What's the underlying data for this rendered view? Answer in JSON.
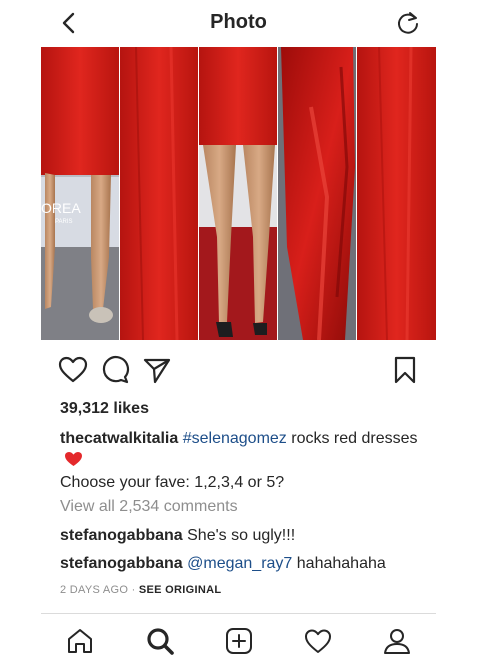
{
  "header": {
    "title": "Photo",
    "back_icon": "chevron-left-icon",
    "refresh_icon": "refresh-icon"
  },
  "photo": {
    "panels": 5,
    "watermark_text": "OREA",
    "watermark_sub": "PARIS",
    "dress_color": "#d9221c"
  },
  "actions": {
    "icons": [
      "heart-icon",
      "comment-icon",
      "share-icon",
      "bookmark-icon"
    ]
  },
  "post": {
    "likes": "39,312 likes",
    "username": "thecatwalkitalia",
    "hashtag": "#selenagomez",
    "caption_rest": " rocks red dresses",
    "caption_line2": "Choose your fave: 1,2,3,4 or 5?",
    "view_all": "View all 2,534 comments"
  },
  "comments": [
    {
      "user": "stefanogabbana",
      "text": " She's so ugly!!!",
      "mention": ""
    },
    {
      "user": "stefanogabbana",
      "text": " hahahahaha",
      "mention": "@megan_ray7"
    }
  ],
  "meta": {
    "time": "2 DAYS AGO",
    "separator": " · ",
    "see_original": "SEE ORIGINAL"
  },
  "tabbar": {
    "icons": [
      "home-icon",
      "search-icon",
      "new-post-icon",
      "activity-heart-icon",
      "profile-icon"
    ]
  },
  "colors": {
    "link": "#1d4e89",
    "muted": "#8e8e8e",
    "text": "#262626"
  }
}
